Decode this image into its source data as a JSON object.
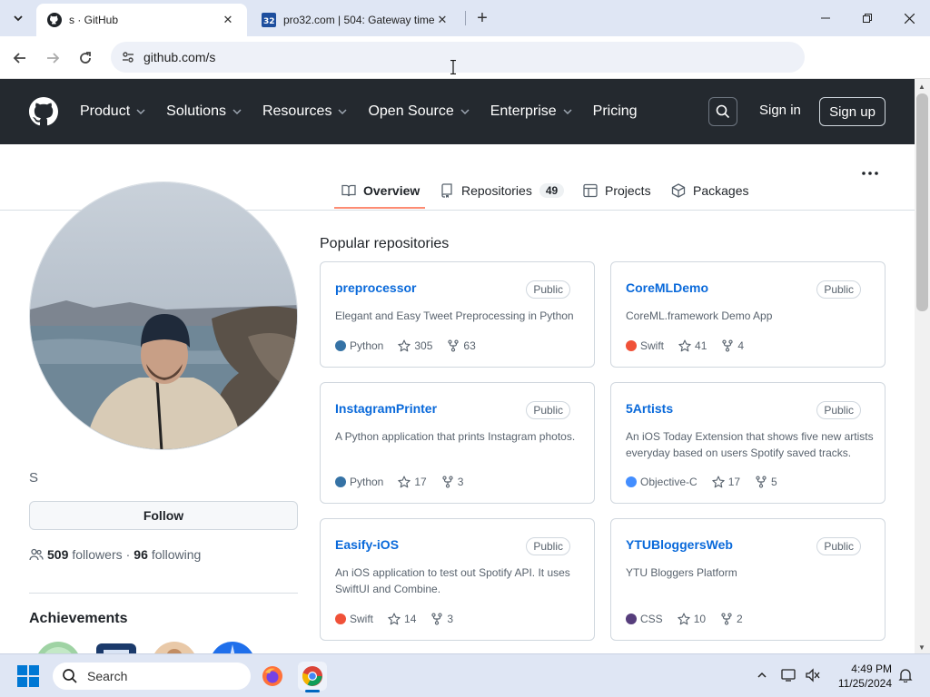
{
  "browser": {
    "tabs": [
      {
        "title": "s · GitHub",
        "active": true
      },
      {
        "title": "pro32.com | 504: Gateway time",
        "active": false
      }
    ],
    "address": {
      "url": "github.com/s"
    }
  },
  "gh_header": {
    "nav": [
      {
        "label": "Product",
        "dropdown": true
      },
      {
        "label": "Solutions",
        "dropdown": true
      },
      {
        "label": "Resources",
        "dropdown": true
      },
      {
        "label": "Open Source",
        "dropdown": true
      },
      {
        "label": "Enterprise",
        "dropdown": true
      },
      {
        "label": "Pricing",
        "dropdown": false
      }
    ],
    "sign_in": "Sign in",
    "sign_up": "Sign up"
  },
  "profile_tabs": {
    "overview": "Overview",
    "repositories": "Repositories",
    "repositories_count": "49",
    "projects": "Projects",
    "packages": "Packages"
  },
  "profile": {
    "username": "S",
    "follow_label": "Follow",
    "followers_count": "509",
    "followers_label": "followers",
    "separator": "·",
    "following_count": "96",
    "following_label": "following",
    "achievements_title": "Achievements"
  },
  "popular": {
    "title": "Popular repositories",
    "repos": [
      {
        "name": "preprocessor",
        "visibility": "Public",
        "description": "Elegant and Easy Tweet Preprocessing in Python",
        "language": "Python",
        "lang_color": "#3572A5",
        "stars": "305",
        "forks": "63"
      },
      {
        "name": "CoreMLDemo",
        "visibility": "Public",
        "description": "CoreML.framework Demo App",
        "language": "Swift",
        "lang_color": "#F05138",
        "stars": "41",
        "forks": "4"
      },
      {
        "name": "InstagramPrinter",
        "visibility": "Public",
        "description": "A Python application that prints Instagram photos.",
        "language": "Python",
        "lang_color": "#3572A5",
        "stars": "17",
        "forks": "3"
      },
      {
        "name": "5Artists",
        "visibility": "Public",
        "description": "An iOS Today Extension that shows five new artists everyday based on users Spotify saved tracks.",
        "language": "Objective-C",
        "lang_color": "#438eff",
        "stars": "17",
        "forks": "5"
      },
      {
        "name": "Easify-iOS",
        "visibility": "Public",
        "description": "An iOS application to test out Spotify API. It uses SwiftUI and Combine.",
        "language": "Swift",
        "lang_color": "#F05138",
        "stars": "14",
        "forks": "3"
      },
      {
        "name": "YTUBloggersWeb",
        "visibility": "Public",
        "description": "YTU Bloggers Platform",
        "language": "CSS",
        "lang_color": "#563d7c",
        "stars": "10",
        "forks": "2"
      }
    ]
  },
  "taskbar": {
    "search_label": "Search",
    "time": "4:49 PM",
    "date": "11/25/2024"
  },
  "colors": {
    "header_bg": "#24292f",
    "link": "#0969da",
    "tab_underline": "#fd8c73"
  }
}
